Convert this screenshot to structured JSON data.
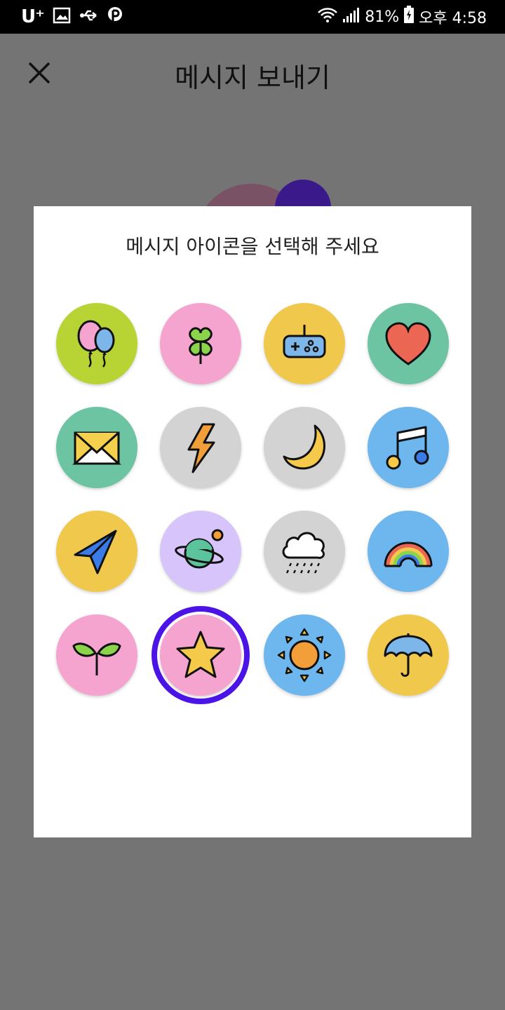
{
  "status_bar": {
    "carrier": "U⁺",
    "battery": "81%",
    "time": "오후 4:58"
  },
  "header": {
    "title": "메시지 보내기",
    "close_icon": "close-icon"
  },
  "dialog": {
    "title": "메시지 아이콘을 선택해 주세요",
    "selected_index": 13,
    "icons": [
      {
        "name": "balloons",
        "bg": "#b8d334"
      },
      {
        "name": "clover",
        "bg": "#f5a3cf"
      },
      {
        "name": "gamepad",
        "bg": "#f0c94c"
      },
      {
        "name": "heart",
        "bg": "#6cc4a2"
      },
      {
        "name": "envelope",
        "bg": "#6cc4a2"
      },
      {
        "name": "lightning",
        "bg": "#d3d3d3"
      },
      {
        "name": "moon",
        "bg": "#d3d3d3"
      },
      {
        "name": "music-note",
        "bg": "#6db6ee"
      },
      {
        "name": "paper-plane",
        "bg": "#f0c94c"
      },
      {
        "name": "planet",
        "bg": "#d7c4fb"
      },
      {
        "name": "rain-cloud",
        "bg": "#d3d3d3"
      },
      {
        "name": "rainbow",
        "bg": "#6db6ee"
      },
      {
        "name": "sprout",
        "bg": "#f5a3cf"
      },
      {
        "name": "star",
        "bg": "#f5a3cf"
      },
      {
        "name": "sun",
        "bg": "#6db6ee"
      },
      {
        "name": "umbrella",
        "bg": "#f0c94c"
      }
    ]
  }
}
